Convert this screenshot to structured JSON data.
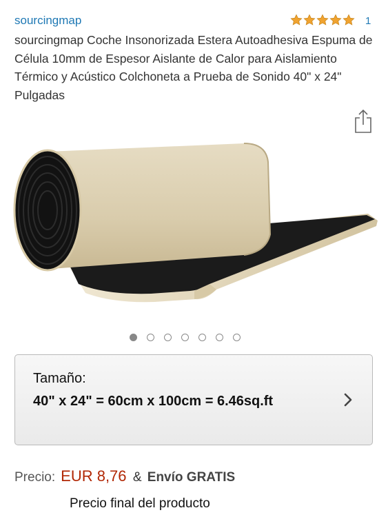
{
  "header": {
    "brand": "sourcingmap",
    "rating_stars": 5,
    "review_count": "1"
  },
  "product": {
    "title": "sourcingmap Coche Insonorizada Estera Autoadhesiva Espuma de Célula 10mm de Espesor Aislante de Calor para Aislamiento Térmico y Acústico Colchoneta a Prueba de Sonido 40\" x 24\" Pulgadas"
  },
  "icons": {
    "share": "share-icon",
    "star": "star-icon",
    "chevron": "chevron-right-icon"
  },
  "carousel": {
    "total_images": 7,
    "active_index": 0
  },
  "variation": {
    "label": "Tamaño:",
    "value": "40\" x 24\" = 60cm x 100cm = 6.46sq.ft"
  },
  "pricing": {
    "label": "Precio:",
    "price": "EUR 8,76",
    "ampersand": "&",
    "shipping": "Envío GRATIS",
    "final_note": "Precio final del producto"
  },
  "colors": {
    "link": "#1e78b4",
    "star": "#f0a330",
    "price": "#b12704"
  }
}
